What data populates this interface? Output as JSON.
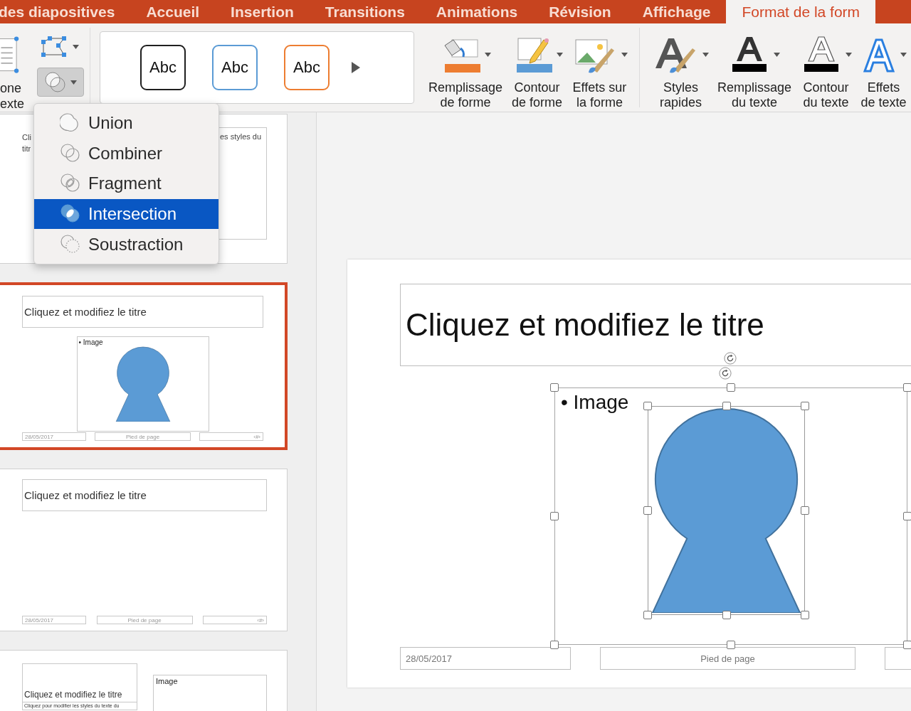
{
  "ribbon_tabs": [
    {
      "label": "des diapositives",
      "selected": false
    },
    {
      "label": "Accueil",
      "selected": false
    },
    {
      "label": "Insertion",
      "selected": false
    },
    {
      "label": "Transitions",
      "selected": false
    },
    {
      "label": "Animations",
      "selected": false
    },
    {
      "label": "Révision",
      "selected": false
    },
    {
      "label": "Affichage",
      "selected": false
    },
    {
      "label": "Format de la form",
      "selected": true
    }
  ],
  "ribbon": {
    "text_box": {
      "lines": [
        "one",
        "exte"
      ]
    },
    "merge_shapes": {
      "pressed": true
    },
    "style_gallery": [
      {
        "label": "Abc",
        "color": "#1f1f1f"
      },
      {
        "label": "Abc",
        "color": "#5b9bd5"
      },
      {
        "label": "Abc",
        "color": "#ed7d31"
      }
    ],
    "buttons": [
      {
        "kind": "shape_fill",
        "lines": [
          "Remplissage",
          "de forme"
        ]
      },
      {
        "kind": "shape_outline",
        "lines": [
          "Contour",
          "de forme"
        ]
      },
      {
        "kind": "shape_effects",
        "lines": [
          "Effets sur",
          "la forme"
        ]
      },
      {
        "kind": "separator"
      },
      {
        "kind": "quick_styles",
        "lines": [
          "Styles",
          "rapides"
        ]
      },
      {
        "kind": "text_fill",
        "lines": [
          "Remplissage",
          "du texte"
        ]
      },
      {
        "kind": "text_outline",
        "lines": [
          "Contour",
          "du texte"
        ]
      },
      {
        "kind": "text_effects",
        "lines": [
          "Effets",
          "de texte"
        ]
      }
    ]
  },
  "merge_menu": {
    "items": [
      {
        "kind": "union",
        "label": "Union",
        "selected": false
      },
      {
        "kind": "combine",
        "label": "Combiner",
        "selected": false
      },
      {
        "kind": "fragment",
        "label": "Fragment",
        "selected": false
      },
      {
        "kind": "intersect",
        "label": "Intersection",
        "selected": true
      },
      {
        "kind": "subtract",
        "label": "Soustraction",
        "selected": false
      }
    ]
  },
  "thumbnails": [
    {
      "kind": "partial",
      "selected": false,
      "title_lines": [
        "Cli",
        "titr"
      ],
      "side_text": "es styles du"
    },
    {
      "kind": "title_picture",
      "selected": true,
      "title": "Cliquez et modifiez le titre",
      "bullet": "• Image",
      "footer": [
        "28/05/2017",
        "Pied de page",
        "‹#›"
      ]
    },
    {
      "kind": "title_only",
      "selected": false,
      "title": "Cliquez et modifiez le titre",
      "footer": [
        "28/05/2017",
        "Pied de page",
        "‹#›"
      ]
    },
    {
      "kind": "two_part",
      "selected": false,
      "title": "Cliquez et modifiez le titre",
      "subtitle": "Cliquez pour modifier les styles du texte du",
      "box_text": "Image"
    }
  ],
  "slide": {
    "title": "Cliquez et modifiez le titre",
    "bullet": "• Image",
    "footer": {
      "date": "28/05/2017",
      "text": "Pied de page"
    }
  }
}
